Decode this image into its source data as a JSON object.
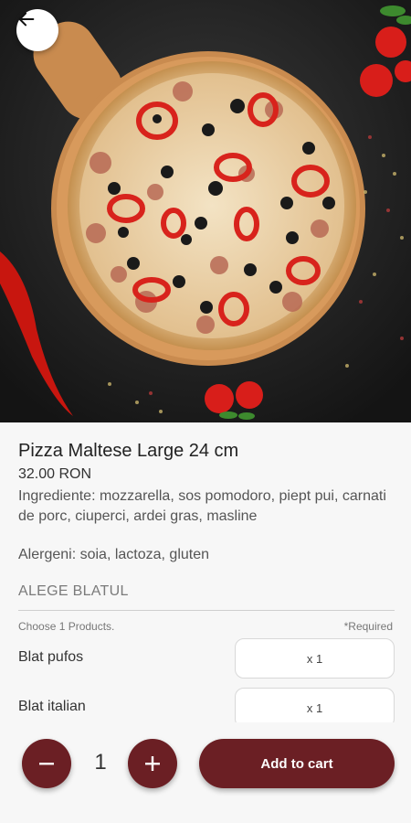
{
  "product": {
    "title": "Pizza Maltese Large 24 cm",
    "price": "32.00 RON",
    "ingredients": "Ingrediente: mozzarella, sos pomodoro, piept pui, carnati de porc, ciuperci, ardei gras, masline",
    "allergens": "Alergeni: soia, lactoza, gluten"
  },
  "options_section": {
    "heading": "ALEGE BLATUL",
    "choose_text": "Choose 1 Products.",
    "required_text": "*Required",
    "options": [
      {
        "label": "Blat pufos",
        "qty": "x 1"
      },
      {
        "label": "Blat italian",
        "qty": "x 1"
      }
    ]
  },
  "cart": {
    "quantity": "1",
    "add_label": "Add to cart"
  },
  "icons": {
    "back": "arrow-left-icon",
    "minus": "minus-icon",
    "plus": "plus-icon"
  },
  "colors": {
    "accent": "#6b1f24",
    "background": "#f7f7f7"
  }
}
